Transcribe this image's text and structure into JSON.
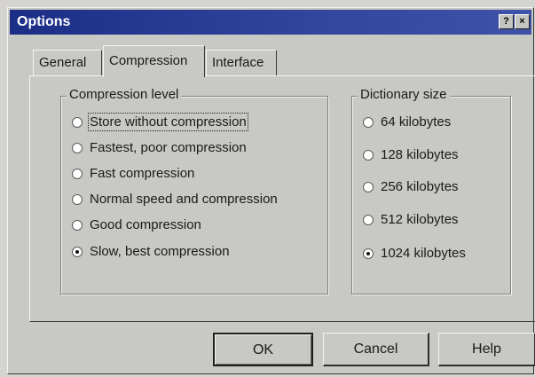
{
  "window": {
    "title": "Options",
    "help_glyph": "?",
    "close_glyph": "×"
  },
  "tabs": [
    {
      "label": "General"
    },
    {
      "label": "Compression",
      "active": true
    },
    {
      "label": "Interface"
    }
  ],
  "compression_group": {
    "legend": "Compression level",
    "options": [
      {
        "label": "Store without compression",
        "selected": false,
        "focused": true
      },
      {
        "label": "Fastest, poor compression",
        "selected": false
      },
      {
        "label": "Fast compression",
        "selected": false
      },
      {
        "label": "Normal speed and compression",
        "selected": false
      },
      {
        "label": "Good compression",
        "selected": false
      },
      {
        "label": "Slow, best compression",
        "selected": true
      }
    ]
  },
  "dictionary_group": {
    "legend": "Dictionary size",
    "options": [
      {
        "label": "64 kilobytes",
        "selected": false
      },
      {
        "label": "128 kilobytes",
        "selected": false
      },
      {
        "label": "256 kilobytes",
        "selected": false
      },
      {
        "label": "512 kilobytes",
        "selected": false
      },
      {
        "label": "1024 kilobytes",
        "selected": true
      }
    ]
  },
  "buttons": {
    "ok": "OK",
    "cancel": "Cancel",
    "help": "Help"
  },
  "colors": {
    "titlebar": "#1c2d86",
    "face": "#c8c8c4"
  }
}
